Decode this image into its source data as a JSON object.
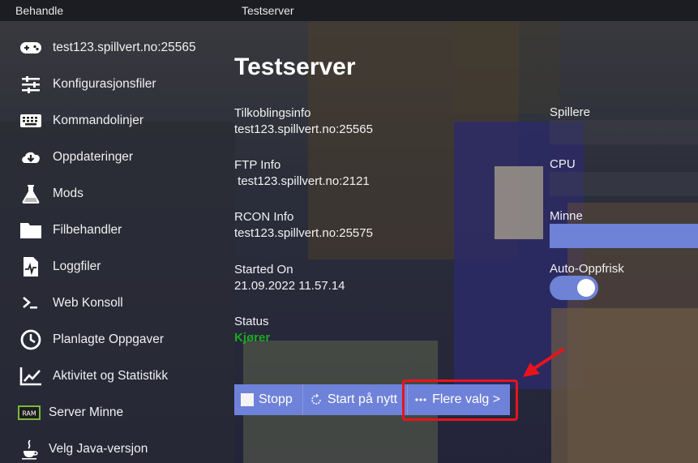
{
  "topbar": {
    "left_title": "Behandle",
    "right_title": "Testserver"
  },
  "sidebar": {
    "items": [
      {
        "label": "test123.spillvert.no:25565",
        "icon": "gamepad-icon"
      },
      {
        "label": "Konfigurasjonsfiler",
        "icon": "sliders-icon"
      },
      {
        "label": "Kommandolinjer",
        "icon": "keyboard-icon"
      },
      {
        "label": "Oppdateringer",
        "icon": "cloud-download-icon"
      },
      {
        "label": "Mods",
        "icon": "flask-icon"
      },
      {
        "label": "Filbehandler",
        "icon": "folder-icon"
      },
      {
        "label": "Loggfiler",
        "icon": "log-file-icon"
      },
      {
        "label": "Web Konsoll",
        "icon": "terminal-icon"
      },
      {
        "label": "Planlagte Oppgaver",
        "icon": "clock-icon"
      },
      {
        "label": "Aktivitet og Statistikk",
        "icon": "chart-line-icon"
      },
      {
        "label": "Server Minne",
        "icon": "ram-icon",
        "icon_text": "RAM"
      },
      {
        "label": "Velg Java-versjon",
        "icon": "java-icon"
      }
    ]
  },
  "main": {
    "title": "Testserver",
    "connection_label": "Tilkoblingsinfo",
    "connection_value": "test123.spillvert.no:25565",
    "ftp_label": "FTP Info",
    "ftp_value": " test123.spillvert.no:2121",
    "rcon_label": "RCON Info",
    "rcon_value": "test123.spillvert.no:25575",
    "started_label": "Started On",
    "started_value": "21.09.2022 11.57.14",
    "status_label": "Status",
    "status_value": "Kjører"
  },
  "stats": {
    "players_label": "Spillere",
    "cpu_label": "CPU",
    "memory_label": "Minne",
    "auto_refresh_label": "Auto-Oppfrisk",
    "auto_refresh_on": true
  },
  "actions": {
    "stop_label": "Stopp",
    "restart_label": "Start på nytt",
    "more_label": "Flere valg >"
  },
  "colors": {
    "accent": "#6f82d9",
    "status_running": "#1ea822",
    "highlight": "#e8141c"
  }
}
